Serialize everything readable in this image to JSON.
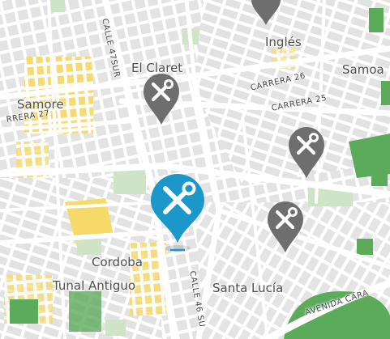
{
  "map": {
    "colors": {
      "background": "#ececec",
      "block": "#e0e0e0",
      "road": "#ffffff",
      "park": "#5cab5b",
      "park_light": "#cfe3c6",
      "residential": "#f6d969",
      "pin_selected": "#1b97c9",
      "pin_default": "#6e6e6e"
    },
    "labels": {
      "ingles": "Inglés",
      "samoa": "Samoa",
      "el_claret": "El Claret",
      "samore": "Samore",
      "cordoba": "Cordoba",
      "tunal_antiguo": "Tunal Antiguo",
      "santa_lucia": "Santa Lucía",
      "carrera_26": "CARRERA 26",
      "carrera_25": "CARRERA 25",
      "carrera_27": "RRERA 27",
      "calle_47_sur": "CALLE 47SUR",
      "calle_46_sur": "CALLE 46 SU",
      "avenida_cara": "AVENIDA CARA"
    },
    "markers": [
      {
        "id": "marker-el-claret",
        "icon": "wrench-screwdriver-icon",
        "state": "default"
      },
      {
        "id": "marker-east",
        "icon": "wrench-screwdriver-icon",
        "state": "default"
      },
      {
        "id": "marker-selected",
        "icon": "wrench-screwdriver-icon",
        "state": "selected"
      },
      {
        "id": "marker-santa-lucia",
        "icon": "wrench-screwdriver-icon",
        "state": "default"
      },
      {
        "id": "marker-top",
        "icon": "wrench-screwdriver-icon",
        "state": "default"
      }
    ]
  }
}
